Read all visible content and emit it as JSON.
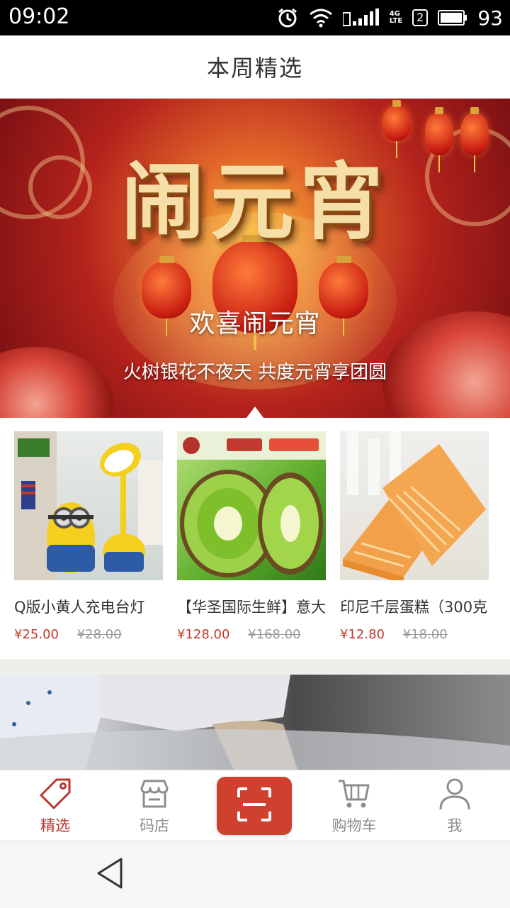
{
  "status_bar": {
    "time": "09:02",
    "sim_slot": "2",
    "network": "4G",
    "network_sub": "LTE",
    "battery": "93"
  },
  "header": {
    "title": "本周精选"
  },
  "banner": {
    "headline": "欢喜闹元宵",
    "subline": "火树银花不夜天 共度元宵享团圆",
    "art_text": "闹元宵",
    "colors": {
      "gold": "#f6dfa7",
      "red": "#b4231c"
    }
  },
  "products": [
    {
      "name": "Q版小黄人充电台灯",
      "price": "¥25.00",
      "old_price": "¥28.00",
      "image": "minion-lamp"
    },
    {
      "name": "【华圣国际生鲜】意大利",
      "price": "¥128.00",
      "old_price": "¥168.00",
      "image": "kiwi-fruit"
    },
    {
      "name": "印尼千层蛋糕（300克",
      "price": "¥12.80",
      "old_price": "¥18.00",
      "image": "layer-cake"
    }
  ],
  "tabs": [
    {
      "label": "精选",
      "icon": "tag-icon",
      "active": true
    },
    {
      "label": "码店",
      "icon": "store-icon",
      "active": false
    },
    {
      "label": "",
      "icon": "scan-icon",
      "active": false
    },
    {
      "label": "购物车",
      "icon": "cart-icon",
      "active": false
    },
    {
      "label": "我",
      "icon": "user-icon",
      "active": false
    }
  ],
  "accent_color": "#d0402f"
}
